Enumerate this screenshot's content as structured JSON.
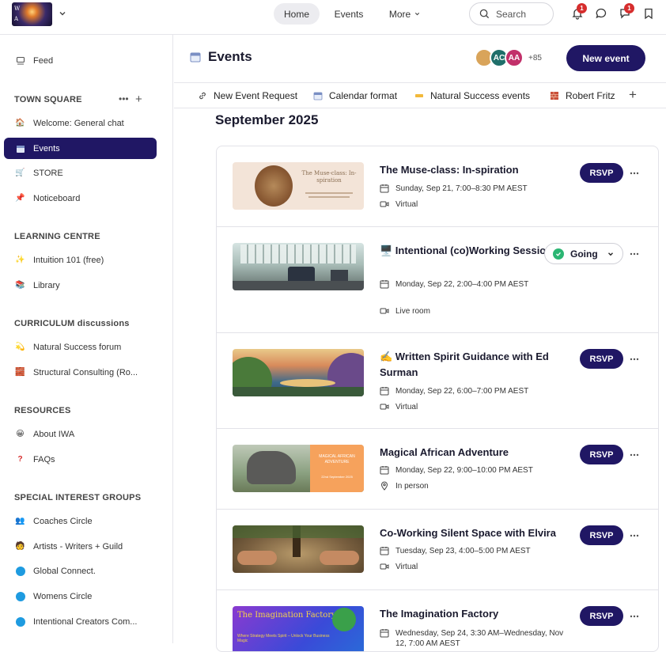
{
  "app": {
    "logo_lines": [
      "W",
      "A"
    ]
  },
  "topnav": {
    "home": "Home",
    "events": "Events",
    "more": "More",
    "search_placeholder": "Search",
    "notif_count": "1",
    "chat_count": "1"
  },
  "sidebar": {
    "feed": "Feed",
    "sections": [
      {
        "title": "TOWN SQUARE",
        "items": [
          {
            "label": "Welcome: General chat",
            "icon": "house-emoji-icon"
          },
          {
            "label": "Events",
            "icon": "calendar-icon",
            "active": true
          },
          {
            "label": "STORE",
            "icon": "cart-icon"
          },
          {
            "label": "Noticeboard",
            "icon": "pushpin-icon"
          }
        ]
      },
      {
        "title": "LEARNING CENTRE",
        "items": [
          {
            "label": "Intuition 101 (free)",
            "icon": "sparkle-icon"
          },
          {
            "label": "Library",
            "icon": "library-icon"
          }
        ]
      },
      {
        "title": "CURRICULUM discussions",
        "items": [
          {
            "label": "Natural Success forum",
            "icon": "dizzy-star-icon"
          },
          {
            "label": "Structural Consulting (Ro...",
            "icon": "brick-icon"
          }
        ]
      },
      {
        "title": "RESOURCES",
        "items": [
          {
            "label": "About IWA",
            "icon": "smile-icon"
          },
          {
            "label": "FAQs",
            "icon": "question-icon"
          }
        ]
      },
      {
        "title": "SPECIAL INTEREST GROUPS",
        "items": [
          {
            "label": "Coaches Circle",
            "icon": "people-icon"
          },
          {
            "label": "Artists - Writers + Guild",
            "icon": "artist-icon"
          },
          {
            "label": "Global Connect.",
            "icon": "dot-icon"
          },
          {
            "label": "Womens Circle",
            "icon": "dot-icon"
          },
          {
            "label": "Intentional Creators Com...",
            "icon": "dot-icon"
          }
        ]
      }
    ]
  },
  "main": {
    "title": "Events",
    "avatars": [
      {
        "initials": "",
        "color": "#d9a45a"
      },
      {
        "initials": "AC",
        "color": "#1f6f6a"
      },
      {
        "initials": "AA",
        "color": "#c2306a"
      }
    ],
    "avatar_more": "+85",
    "new_event": "New event",
    "tabs": [
      {
        "label": "New Event Request",
        "icon": "link-icon"
      },
      {
        "label": "Calendar format",
        "icon": "calendar-icon"
      },
      {
        "label": "Natural Success events",
        "icon": "ticket-icon"
      },
      {
        "label": "Robert Fritz",
        "icon": "brick-icon"
      }
    ],
    "month": "September 2025",
    "events": [
      {
        "title": "The Muse-class: In-spiration",
        "date": "Sunday, Sep 21, 7:00–8:30 PM AEST",
        "location": "Virtual",
        "location_type": "video",
        "action": "RSVP",
        "thumb_text": "The Muse-class: In-spiration"
      },
      {
        "title": "🖥️ Intentional (co)Working Session",
        "date": "Monday, Sep 22, 2:00–4:00 PM AEST",
        "location": "Live room",
        "location_type": "video",
        "action": "Going"
      },
      {
        "title": "✍️ Written Spirit Guidance with Ed Surman",
        "date": "Monday, Sep 22, 6:00–7:00 PM AEST",
        "location": "Virtual",
        "location_type": "video",
        "action": "RSVP"
      },
      {
        "title": "Magical African Adventure",
        "date": "Monday, Sep 22, 9:00–10:00 PM AEST",
        "location": "In person",
        "location_type": "pin",
        "action": "RSVP",
        "thumb_text": "MAGICAL AFRICAN ADVENTURE",
        "thumb_date": "22nd September 2025"
      },
      {
        "title": "Co-Working Silent Space with Elvira",
        "date": "Tuesday, Sep 23, 4:00–5:00 PM AEST",
        "location": "Virtual",
        "location_type": "video",
        "action": "RSVP"
      },
      {
        "title": "The Imagination Factory",
        "date": "Wednesday, Sep 24, 3:30 AM–Wednesday, Nov 12, 7:00 AM AEST",
        "location": "",
        "location_type": "video",
        "action": "RSVP",
        "thumb_text": "The Imagination Factory",
        "thumb_sub": "Where Strategy Meets Spirit – Unlock Your Business Magic"
      }
    ]
  },
  "colors": {
    "primary": "#201764",
    "badge": "#d62d2d",
    "going": "#2bb673",
    "dot": "#1e9be0"
  }
}
